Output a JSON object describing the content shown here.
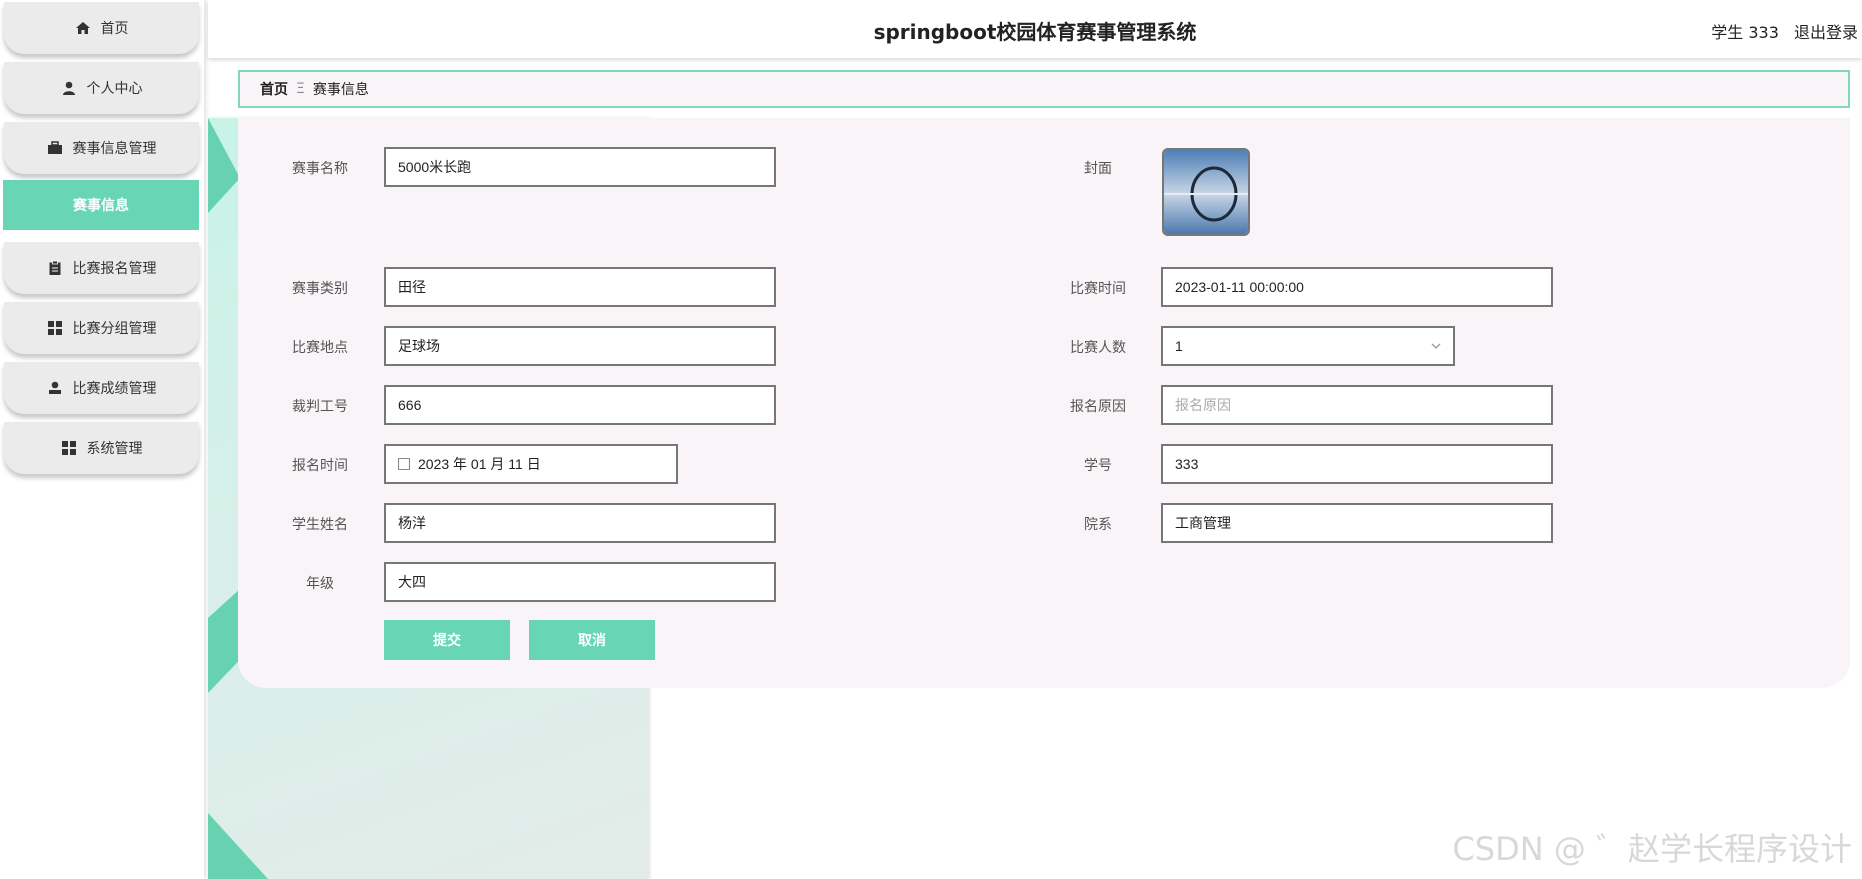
{
  "header": {
    "title": "springboot校园体育赛事管理系统",
    "user": "学生 333",
    "logout": "退出登录"
  },
  "sidebar": {
    "items": [
      {
        "label": "首页",
        "icon": "home-icon"
      },
      {
        "label": "个人中心",
        "icon": "user-icon"
      },
      {
        "label": "赛事信息管理",
        "icon": "briefcase-icon"
      },
      {
        "label": "赛事信息",
        "icon": "",
        "active": true
      },
      {
        "label": "比赛报名管理",
        "icon": "clipboard-icon"
      },
      {
        "label": "比赛分组管理",
        "icon": "grid-icon"
      },
      {
        "label": "比赛成绩管理",
        "icon": "person-icon"
      },
      {
        "label": "系统管理",
        "icon": "grid-icon"
      }
    ]
  },
  "breadcrumb": {
    "home": "首页",
    "separator": "Ξ",
    "current": "赛事信息"
  },
  "form": {
    "labels": {
      "name": "赛事名称",
      "cover": "封面",
      "category": "赛事类别",
      "time": "比赛时间",
      "location": "比赛地点",
      "count": "比赛人数",
      "referee": "裁判工号",
      "reason": "报名原因",
      "reg_time": "报名时间",
      "student_no": "学号",
      "student_name": "学生姓名",
      "department": "院系",
      "grade": "年级"
    },
    "values": {
      "name": "5000米长跑",
      "category": "田径",
      "time": "2023-01-11 00:00:00",
      "location": "足球场",
      "count": "1",
      "referee": "666",
      "reason_placeholder": "报名原因",
      "reg_time": "2023 年 01 月 11 日",
      "student_no": "333",
      "student_name": "杨洋",
      "department": "工商管理",
      "grade": "大四"
    },
    "submit": "提交",
    "cancel": "取消"
  },
  "watermark": "CSDN @ ゛赵学长程序设计",
  "colors": {
    "accent": "#68d6b4",
    "card_bg": "#f9f4f7"
  }
}
